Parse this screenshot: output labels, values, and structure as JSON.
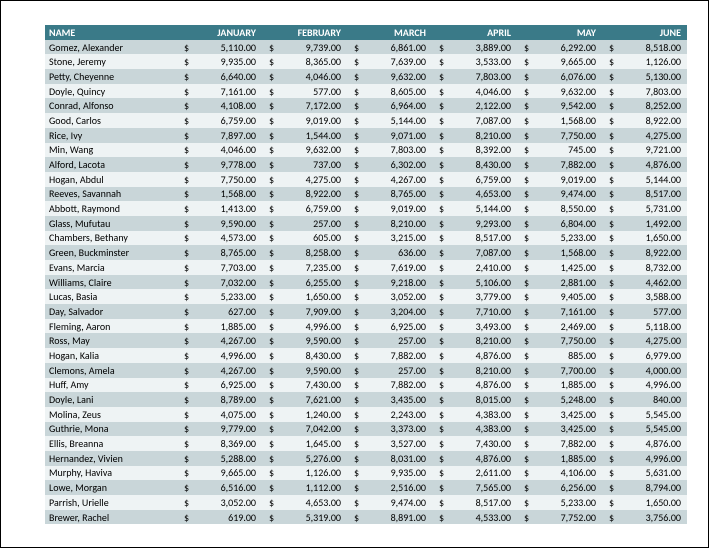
{
  "chart_data": {
    "type": "table",
    "columns": [
      "NAME",
      "JANUARY",
      "FEBRUARY",
      "MARCH",
      "APRIL",
      "MAY",
      "JUNE"
    ],
    "rows": [
      {
        "name": "Gomez, Alexander",
        "vals": [
          "5,110.00",
          "9,739.00",
          "6,861.00",
          "3,889.00",
          "6,292.00",
          "8,518.00"
        ]
      },
      {
        "name": "Stone, Jeremy",
        "vals": [
          "9,935.00",
          "8,365.00",
          "7,639.00",
          "3,533.00",
          "9,665.00",
          "1,126.00"
        ]
      },
      {
        "name": "Petty, Cheyenne",
        "vals": [
          "6,640.00",
          "4,046.00",
          "9,632.00",
          "7,803.00",
          "6,076.00",
          "5,130.00"
        ]
      },
      {
        "name": "Doyle, Quincy",
        "vals": [
          "7,161.00",
          "577.00",
          "8,605.00",
          "4,046.00",
          "9,632.00",
          "7,803.00"
        ]
      },
      {
        "name": "Conrad, Alfonso",
        "vals": [
          "4,108.00",
          "7,172.00",
          "6,964.00",
          "2,122.00",
          "9,542.00",
          "8,252.00"
        ]
      },
      {
        "name": "Good, Carlos",
        "vals": [
          "6,759.00",
          "9,019.00",
          "5,144.00",
          "7,087.00",
          "1,568.00",
          "8,922.00"
        ]
      },
      {
        "name": "Rice, Ivy",
        "vals": [
          "7,897.00",
          "1,544.00",
          "9,071.00",
          "8,210.00",
          "7,750.00",
          "4,275.00"
        ]
      },
      {
        "name": "Min, Wang",
        "vals": [
          "4,046.00",
          "9,632.00",
          "7,803.00",
          "8,392.00",
          "745.00",
          "9,721.00"
        ]
      },
      {
        "name": "Alford, Lacota",
        "vals": [
          "9,778.00",
          "737.00",
          "6,302.00",
          "8,430.00",
          "7,882.00",
          "4,876.00"
        ]
      },
      {
        "name": "Hogan, Abdul",
        "vals": [
          "7,750.00",
          "4,275.00",
          "4,267.00",
          "6,759.00",
          "9,019.00",
          "5,144.00"
        ]
      },
      {
        "name": "Reeves, Savannah",
        "vals": [
          "1,568.00",
          "8,922.00",
          "8,765.00",
          "4,653.00",
          "9,474.00",
          "8,517.00"
        ]
      },
      {
        "name": "Abbott, Raymond",
        "vals": [
          "1,413.00",
          "6,759.00",
          "9,019.00",
          "5,144.00",
          "8,550.00",
          "5,731.00"
        ]
      },
      {
        "name": "Glass, Mufutau",
        "vals": [
          "9,590.00",
          "257.00",
          "8,210.00",
          "9,293.00",
          "6,804.00",
          "1,492.00"
        ]
      },
      {
        "name": "Chambers, Bethany",
        "vals": [
          "4,573.00",
          "605.00",
          "3,215.00",
          "8,517.00",
          "5,233.00",
          "1,650.00"
        ]
      },
      {
        "name": "Green, Buckminster",
        "vals": [
          "8,765.00",
          "8,258.00",
          "636.00",
          "7,087.00",
          "1,568.00",
          "8,922.00"
        ]
      },
      {
        "name": "Evans, Marcia",
        "vals": [
          "7,703.00",
          "7,235.00",
          "7,619.00",
          "2,410.00",
          "1,425.00",
          "8,732.00"
        ]
      },
      {
        "name": "Williams, Claire",
        "vals": [
          "7,032.00",
          "6,255.00",
          "9,218.00",
          "5,106.00",
          "2,881.00",
          "4,462.00"
        ]
      },
      {
        "name": "Lucas, Basia",
        "vals": [
          "5,233.00",
          "1,650.00",
          "3,052.00",
          "3,779.00",
          "9,405.00",
          "3,588.00"
        ]
      },
      {
        "name": "Day, Salvador",
        "vals": [
          "627.00",
          "7,909.00",
          "3,204.00",
          "7,710.00",
          "7,161.00",
          "577.00"
        ]
      },
      {
        "name": "Fleming, Aaron",
        "vals": [
          "1,885.00",
          "4,996.00",
          "6,925.00",
          "3,493.00",
          "2,469.00",
          "5,118.00"
        ]
      },
      {
        "name": "Ross, May",
        "vals": [
          "4,267.00",
          "9,590.00",
          "257.00",
          "8,210.00",
          "7,750.00",
          "4,275.00"
        ]
      },
      {
        "name": "Hogan, Kalia",
        "vals": [
          "4,996.00",
          "8,430.00",
          "7,882.00",
          "4,876.00",
          "885.00",
          "6,979.00"
        ]
      },
      {
        "name": "Clemons, Amela",
        "vals": [
          "4,267.00",
          "9,590.00",
          "257.00",
          "8,210.00",
          "7,700.00",
          "4,000.00"
        ]
      },
      {
        "name": "Huff, Amy",
        "vals": [
          "6,925.00",
          "7,430.00",
          "7,882.00",
          "4,876.00",
          "1,885.00",
          "4,996.00"
        ]
      },
      {
        "name": "Doyle, Lani",
        "vals": [
          "8,789.00",
          "7,621.00",
          "3,435.00",
          "8,015.00",
          "5,248.00",
          "840.00"
        ]
      },
      {
        "name": "Molina, Zeus",
        "vals": [
          "4,075.00",
          "1,240.00",
          "2,243.00",
          "4,383.00",
          "3,425.00",
          "5,545.00"
        ]
      },
      {
        "name": "Guthrie, Mona",
        "vals": [
          "9,779.00",
          "7,042.00",
          "3,373.00",
          "4,383.00",
          "3,425.00",
          "5,545.00"
        ]
      },
      {
        "name": "Ellis, Breanna",
        "vals": [
          "8,369.00",
          "1,645.00",
          "3,527.00",
          "7,430.00",
          "7,882.00",
          "4,876.00"
        ]
      },
      {
        "name": "Hernandez, Vivien",
        "vals": [
          "5,288.00",
          "5,276.00",
          "8,031.00",
          "4,876.00",
          "1,885.00",
          "4,996.00"
        ]
      },
      {
        "name": "Murphy, Haviva",
        "vals": [
          "9,665.00",
          "1,126.00",
          "9,935.00",
          "2,611.00",
          "4,106.00",
          "5,631.00"
        ]
      },
      {
        "name": "Lowe, Morgan",
        "vals": [
          "6,516.00",
          "1,112.00",
          "2,516.00",
          "7,565.00",
          "6,256.00",
          "8,794.00"
        ]
      },
      {
        "name": "Parrish, Urielle",
        "vals": [
          "3,052.00",
          "4,653.00",
          "9,474.00",
          "8,517.00",
          "5,233.00",
          "1,650.00"
        ]
      },
      {
        "name": "Brewer, Rachel",
        "vals": [
          "619.00",
          "5,319.00",
          "8,891.00",
          "4,533.00",
          "7,752.00",
          "3,756.00"
        ]
      }
    ]
  },
  "currency": "$"
}
